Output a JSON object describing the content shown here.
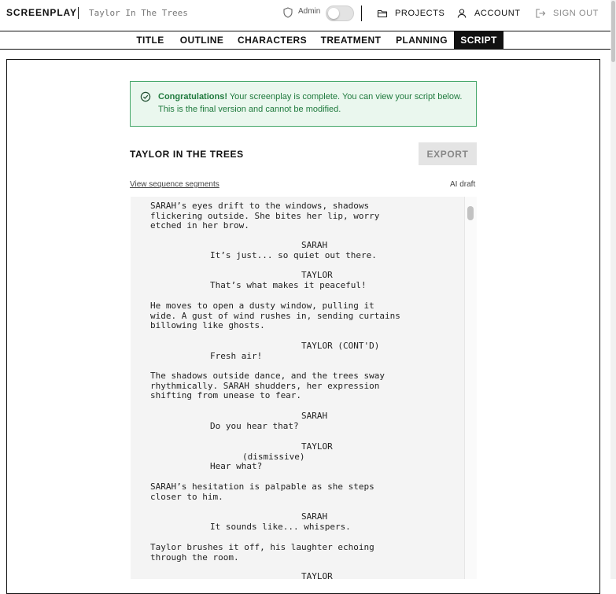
{
  "header": {
    "brand": "SCREENPLAY",
    "project_name": "Taylor In The Trees",
    "admin_label": "Admin",
    "admin_enabled": false,
    "projects_label": "PROJECTS",
    "account_label": "ACCOUNT",
    "signout_label": "SIGN OUT"
  },
  "tabs": [
    {
      "label": "TITLE",
      "active": false
    },
    {
      "label": "OUTLINE",
      "active": false
    },
    {
      "label": "CHARACTERS",
      "active": false
    },
    {
      "label": "TREATMENT",
      "active": false
    },
    {
      "label": "PLANNING",
      "active": false
    },
    {
      "label": "SCRIPT",
      "active": true
    }
  ],
  "alert": {
    "title": "Congratulations!",
    "message": " Your screenplay is complete. You can view your script below. This is the final version and cannot be modified."
  },
  "script": {
    "title": "TAYLOR IN THE TREES",
    "export_label": "EXPORT",
    "sequence_link": "View sequence segments",
    "draft_label": "AI draft",
    "lines": [
      {
        "type": "action",
        "text": "SARAH’s eyes drift to the windows, shadows\nflickering outside. She bites her lip, worry\netched in her brow."
      },
      {
        "type": "character",
        "text": "SARAH"
      },
      {
        "type": "dialogue",
        "text": "It’s just... so quiet out there."
      },
      {
        "type": "character",
        "text": "TAYLOR"
      },
      {
        "type": "dialogue",
        "text": "That’s what makes it peaceful!"
      },
      {
        "type": "action",
        "text": "He moves to open a dusty window, pulling it\nwide. A gust of wind rushes in, sending curtains\nbillowing like ghosts."
      },
      {
        "type": "character",
        "text": "TAYLOR (CONT'D)"
      },
      {
        "type": "dialogue",
        "text": "Fresh air!"
      },
      {
        "type": "action",
        "text": "The shadows outside dance, and the trees sway\nrhythmically. SARAH shudders, her expression\nshifting from unease to fear."
      },
      {
        "type": "character",
        "text": "SARAH"
      },
      {
        "type": "dialogue",
        "text": "Do you hear that?"
      },
      {
        "type": "character",
        "text": "TAYLOR"
      },
      {
        "type": "paren",
        "text": "(dismissive)"
      },
      {
        "type": "dialogue",
        "text": "Hear what?"
      },
      {
        "type": "action",
        "text": "SARAH’s hesitation is palpable as she steps\ncloser to him."
      },
      {
        "type": "character",
        "text": "SARAH"
      },
      {
        "type": "dialogue",
        "text": "It sounds like... whispers."
      },
      {
        "type": "action",
        "text": "Taylor brushes it off, his laughter echoing\nthrough the room."
      },
      {
        "type": "character",
        "text": "TAYLOR"
      }
    ]
  },
  "colors": {
    "alert_bg": "#eaf7ee",
    "alert_border": "#46a76a",
    "alert_text": "#1f7a3d",
    "active_tab_bg": "#111111"
  },
  "icons": {
    "admin": "shield-icon",
    "projects": "folder-icon",
    "account": "user-icon",
    "signout": "sign-out-icon",
    "alert": "check-circle-icon"
  }
}
